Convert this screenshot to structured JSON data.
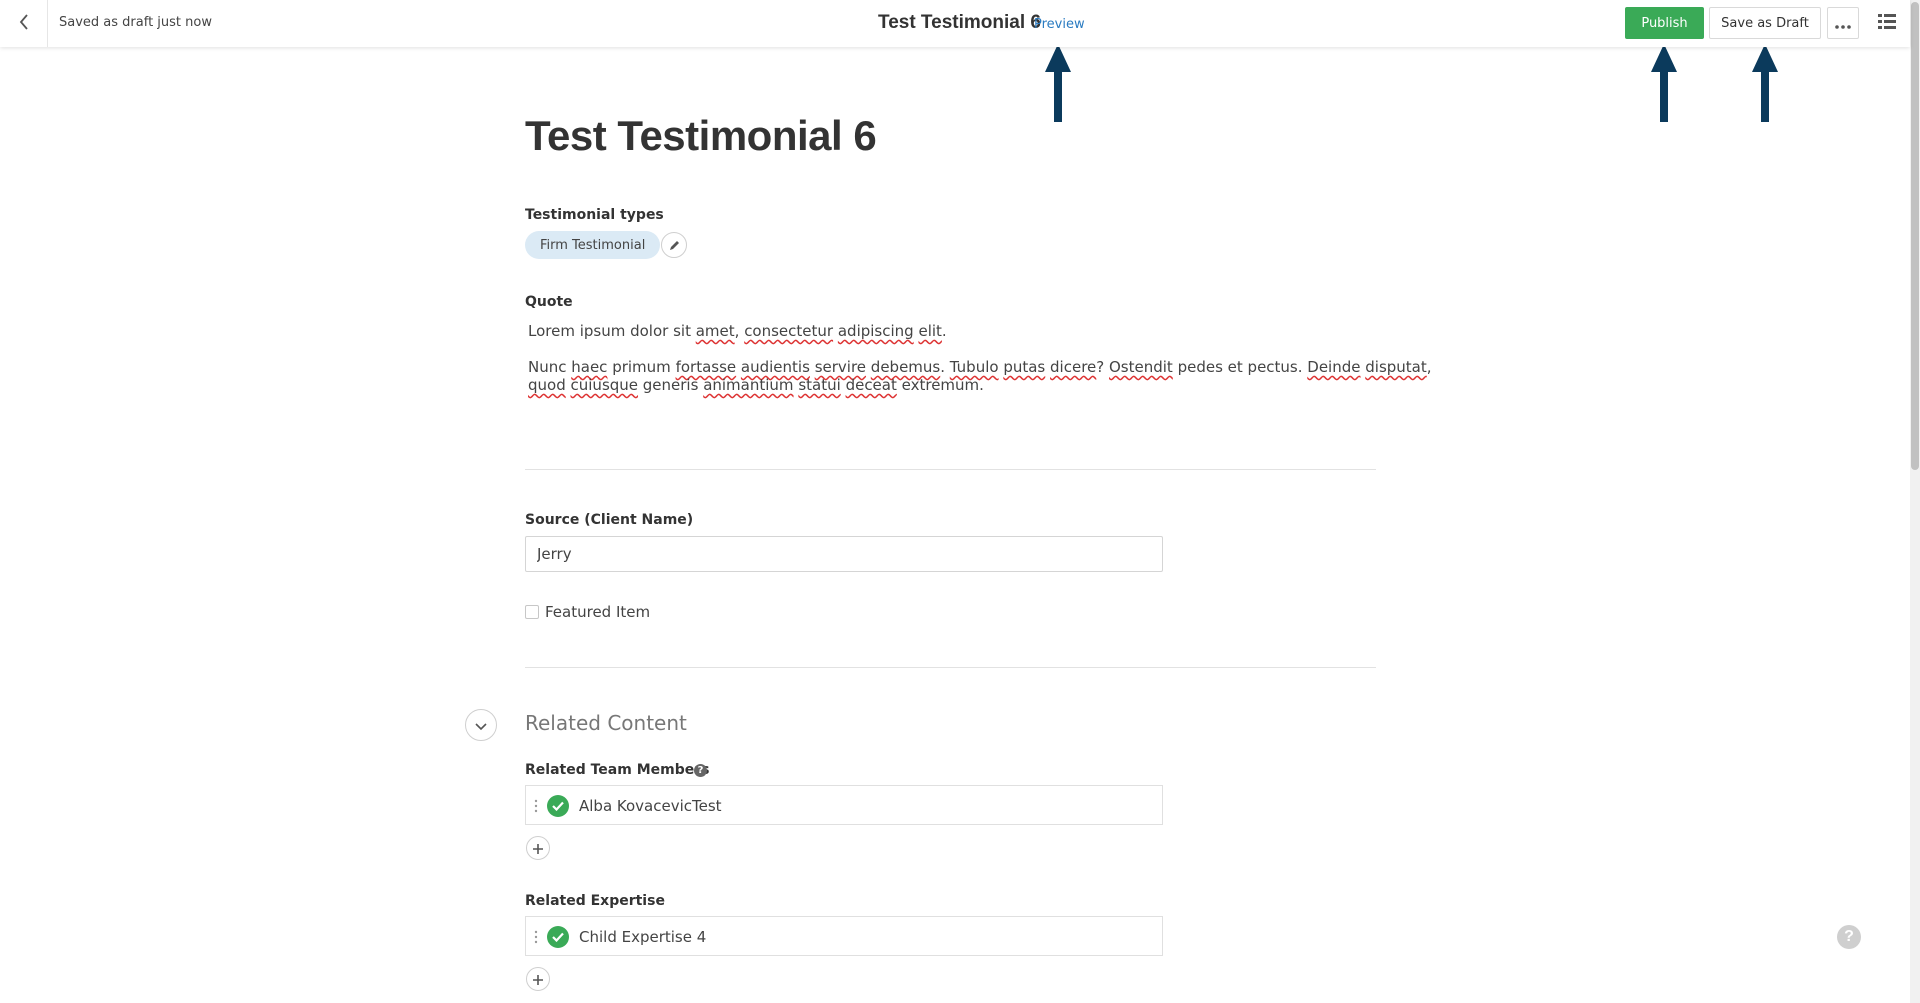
{
  "header": {
    "save_status": "Saved as draft just now",
    "title": "Test Testimonial 6",
    "preview_label": "Preview",
    "publish_label": "Publish",
    "save_draft_label": "Save as Draft"
  },
  "colors": {
    "publish_green": "#3aaa57",
    "arrow_navy": "#0b3a5c",
    "link_blue": "#2a7bc1",
    "tag_bg": "#dbeaf5"
  },
  "icons": {
    "back": "chevron-left-icon",
    "more": "ellipsis-icon",
    "panel": "list-view-icon",
    "edit": "pencil-icon",
    "collapse": "chevron-down-icon",
    "check": "check-circle-icon",
    "drag": "drag-handle-icon",
    "add": "plus-icon",
    "help": "question-icon"
  },
  "page": {
    "heading": "Test Testimonial 6"
  },
  "testimonial_types": {
    "label": "Testimonial types",
    "tags": [
      "Firm Testimonial"
    ]
  },
  "quote": {
    "label": "Quote",
    "p1": "Lorem ipsum dolor sit amet, consectetur adipiscing elit.",
    "p2_line1": "Nunc haec primum fortasse audientis servire debemus. Tubulo putas dicere? Ostendit pedes et pectus. Deinde disputat,",
    "p2_line2": "quod cuiusque generis animantium statui deceat extremum."
  },
  "source": {
    "label": "Source (Client Name)",
    "value": "Jerry"
  },
  "featured": {
    "label": "Featured Item",
    "checked": false
  },
  "related_content": {
    "title": "Related Content",
    "team_members": {
      "label": "Related Team Members",
      "items": [
        "Alba KovacevicTest"
      ]
    },
    "expertise": {
      "label": "Related Expertise",
      "items": [
        "Child Expertise 4"
      ]
    }
  }
}
